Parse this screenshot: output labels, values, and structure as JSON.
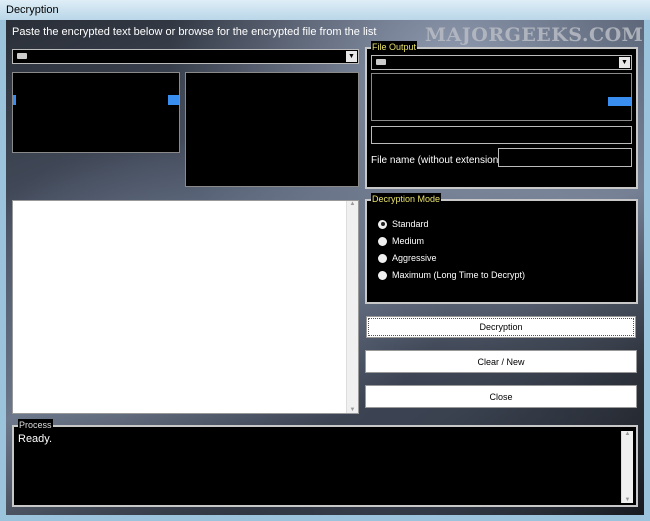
{
  "window": {
    "title": "Decryption"
  },
  "watermark": "MAJORGEEKS.COM",
  "instruction": "Paste the encrypted text below or browse for the encrypted file from the list",
  "file_output": {
    "legend": "File Output",
    "filename_label": "File name (without extension)",
    "filename_value": "",
    "output_path": ""
  },
  "mode": {
    "legend": "Decryption Mode",
    "options": [
      "Standard",
      "Medium",
      "Aggressive",
      "Maximum (Long Time to Decrypt)"
    ],
    "selected": "Standard"
  },
  "buttons": {
    "decrypt": "Decryption",
    "clear": "Clear / New",
    "close": "Close"
  },
  "process": {
    "legend": "Process",
    "text": "Ready."
  },
  "colors": {
    "selection": "#3a8ef0",
    "legend": "#e8e26a"
  }
}
